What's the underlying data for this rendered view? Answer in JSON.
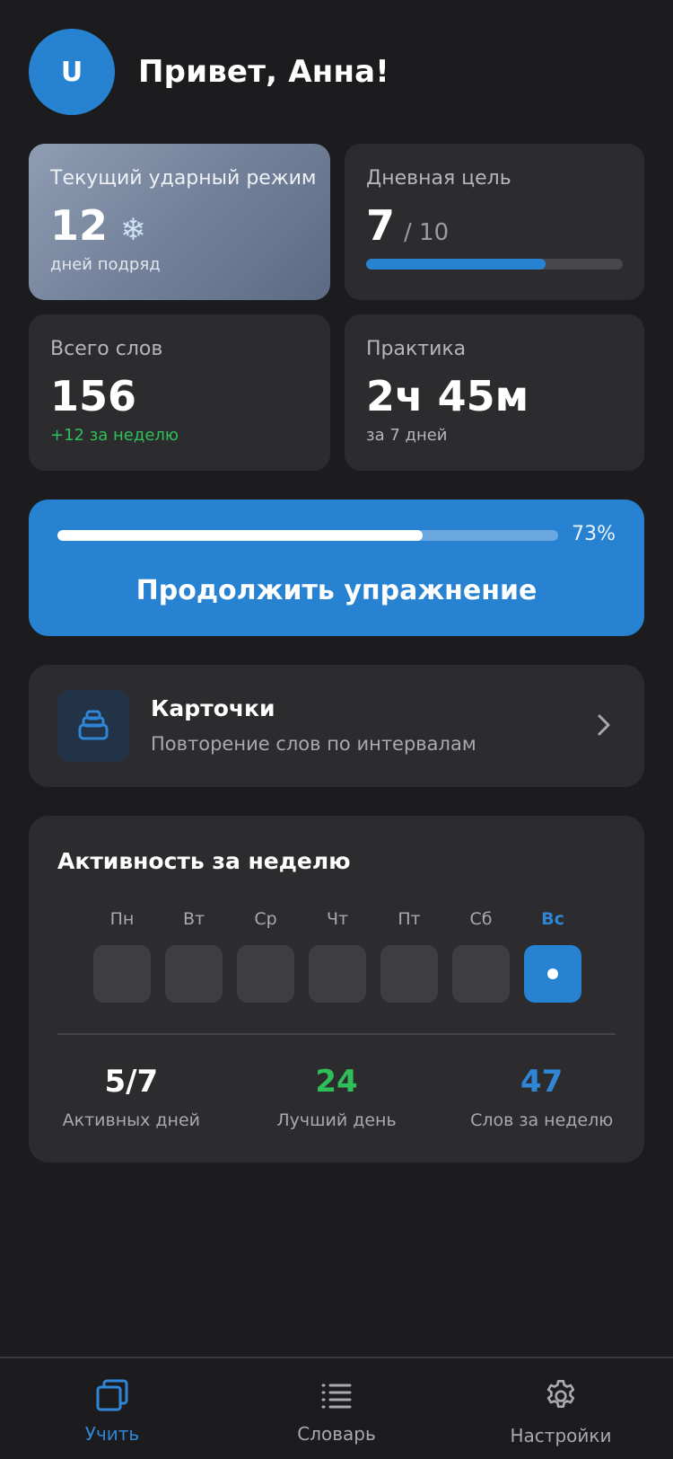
{
  "header": {
    "avatar_initial": "U",
    "greeting": "Привет, Анна!"
  },
  "cards": {
    "streak": {
      "label": "Текущий ударный режим",
      "value": "12",
      "icon": "snowflake-icon",
      "sub": "дней подряд"
    },
    "goal": {
      "label": "Дневная цель",
      "value": "7",
      "total": "/ 10",
      "progress": 0.7
    },
    "words": {
      "label": "Всего слов",
      "value": "156",
      "sub": "+12 за неделю"
    },
    "practice": {
      "label": "Практика",
      "value": "2ч 45м",
      "sub": "за 7 дней"
    }
  },
  "continue": {
    "progress_percent": 73,
    "progress_label": "73%",
    "label": "Продолжить упражнение"
  },
  "flashcards": {
    "title": "Карточки",
    "subtitle": "Повторение слов по интервалам",
    "icon": "card-stack-icon"
  },
  "weekly": {
    "title": "Активность за неделю",
    "days": [
      {
        "name": "Пн",
        "active": false
      },
      {
        "name": "Вт",
        "active": false
      },
      {
        "name": "Ср",
        "active": false
      },
      {
        "name": "Чт",
        "active": false
      },
      {
        "name": "Пт",
        "active": false
      },
      {
        "name": "Сб",
        "active": false
      },
      {
        "name": "Вс",
        "active": true
      }
    ],
    "stats": [
      {
        "value": "5/7",
        "label": "Активных дней",
        "color": "#ffffff"
      },
      {
        "value": "24",
        "label": "Лучший день",
        "color": "#2fbf5a"
      },
      {
        "value": "47",
        "label": "Слов за неделю",
        "color": "#2f86d6"
      }
    ]
  },
  "nav": [
    {
      "label": "Учить",
      "icon": "cards-icon",
      "active": true
    },
    {
      "label": "Словарь",
      "icon": "list-icon",
      "active": false
    },
    {
      "label": "Настройки",
      "icon": "gear-icon",
      "active": false
    }
  ],
  "colors": {
    "accent": "#2783d1",
    "background": "#1c1c1e",
    "card": "#2c2c2e",
    "positive": "#2fbf5a"
  }
}
